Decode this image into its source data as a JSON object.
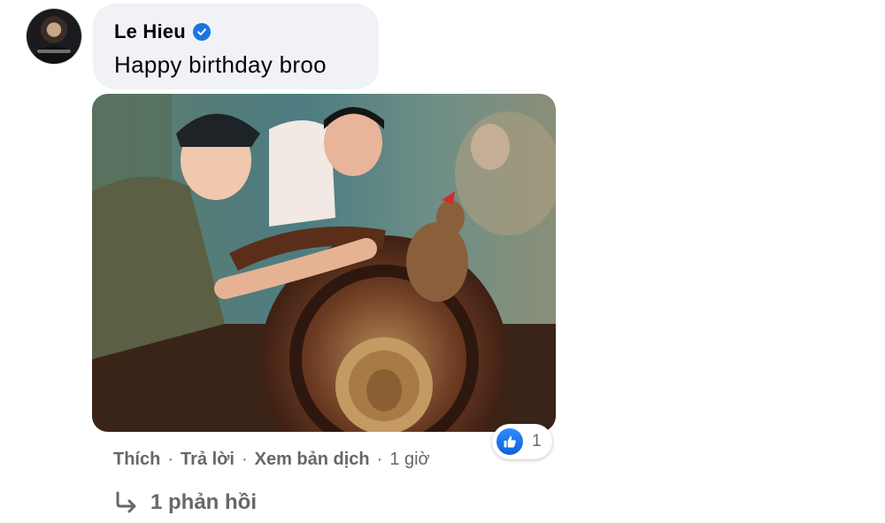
{
  "comment": {
    "author": "Le Hieu",
    "verified": true,
    "text": "Happy birthday broo",
    "reaction_count": "1",
    "reaction_type": "like-icon",
    "actions": {
      "like": "Thích",
      "reply": "Trả lời",
      "translate": "Xem bản dịch",
      "separator": "·",
      "time": "1 giờ"
    },
    "replies_label": "1 phản hồi"
  },
  "colors": {
    "bubble_bg": "#f0f2f5",
    "brand_blue": "#1b74e4",
    "secondary_text": "#65676b",
    "primary_text": "#050505"
  }
}
